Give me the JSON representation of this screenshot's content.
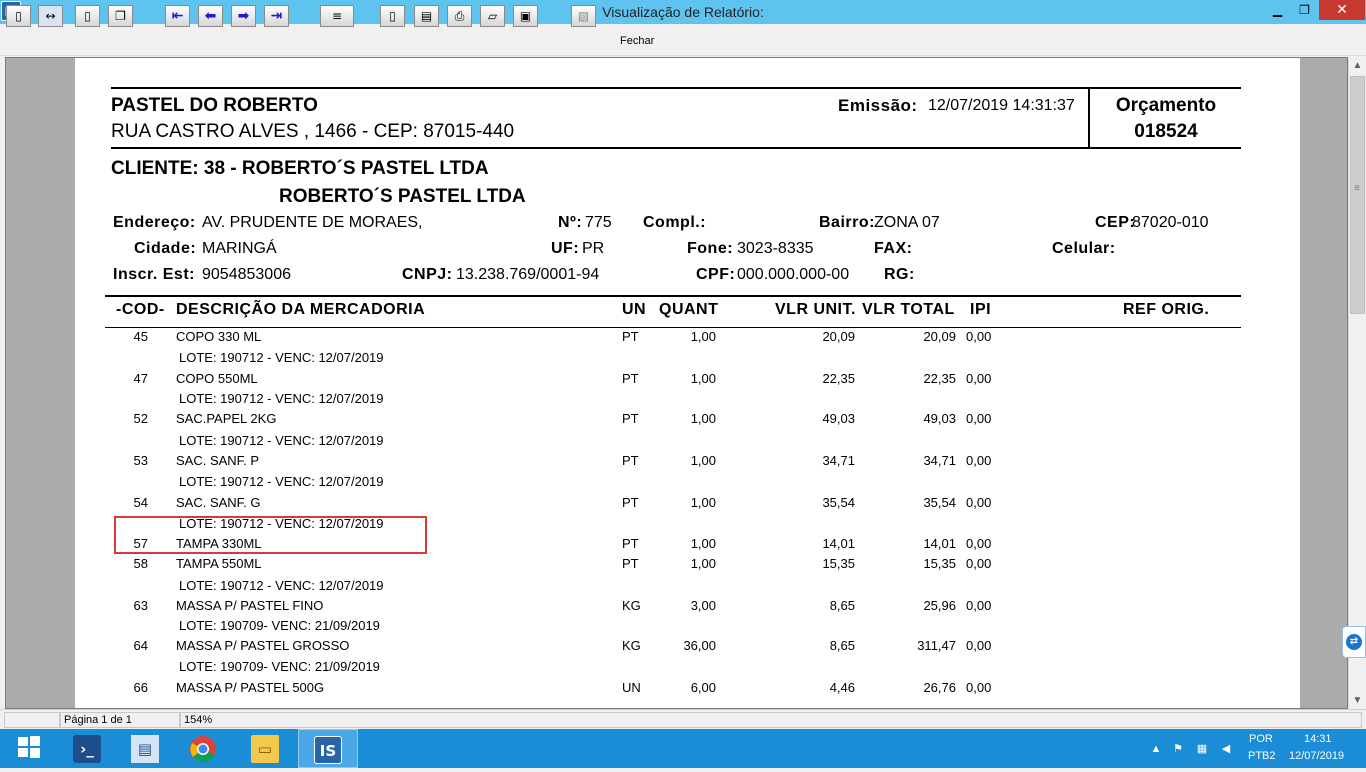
{
  "window": {
    "title": "Visualização de Relatório:",
    "app_icon": "IS",
    "min": "▁",
    "max": "❐",
    "close": "✕"
  },
  "toolbar": {
    "buttons": [
      {
        "name": "one-page-icon",
        "glyph": "▯"
      },
      {
        "name": "page-width-icon",
        "glyph": "↔"
      },
      {
        "name": "full-page-icon",
        "glyph": "▯"
      },
      {
        "name": "multi-page-icon",
        "glyph": "❐"
      },
      {
        "name": "first-page-icon",
        "glyph": "⇤"
      },
      {
        "name": "prev-page-icon",
        "glyph": "⬅"
      },
      {
        "name": "next-page-icon",
        "glyph": "➡"
      },
      {
        "name": "last-page-icon",
        "glyph": "⇥"
      },
      {
        "name": "goto-page-icon",
        "glyph": "≡"
      },
      {
        "name": "new-document-icon",
        "glyph": "▯"
      },
      {
        "name": "print-setup-icon",
        "glyph": "▤"
      },
      {
        "name": "print-icon",
        "glyph": "⎙"
      },
      {
        "name": "open-folder-icon",
        "glyph": "▱"
      },
      {
        "name": "save-icon",
        "glyph": "▣"
      },
      {
        "name": "disabled-icon",
        "glyph": "▧"
      }
    ],
    "close_label": "Fechar"
  },
  "report": {
    "company_name": "PASTEL DO ROBERTO",
    "company_address": "RUA CASTRO ALVES , 1466 - CEP: 87015-440",
    "emission_label": "Emissão:",
    "emission_value": "12/07/2019 14:31:37",
    "doc_type": "Orçamento",
    "doc_number": "018524",
    "client_line": "CLIENTE: 38 - ROBERTO´S PASTEL LTDA",
    "client_name": "ROBERTO´S PASTEL LTDA",
    "endereco_label": "Endereço:",
    "endereco_value": "AV. PRUDENTE DE MORAES,",
    "numero_label": "Nº:",
    "numero_value": "775",
    "compl_label": "Compl.:",
    "bairro_label": "Bairro:",
    "bairro_value": "ZONA 07",
    "cep_label": "CEP:",
    "cep_value": "87020-010",
    "cidade_label": "Cidade:",
    "cidade_value": "MARINGÁ",
    "uf_label": "UF:",
    "uf_value": "PR",
    "fone_label": "Fone:",
    "fone_value": "3023-8335",
    "fax_label": "FAX:",
    "celular_label": "Celular:",
    "inscr_label": "Inscr. Est:",
    "inscr_value": "9054853006",
    "cnpj_label": "CNPJ:",
    "cnpj_value": "13.238.769/0001-94",
    "cpf_label": "CPF:",
    "cpf_value": "000.000.000-00",
    "rg_label": "RG:",
    "columns": {
      "cod": "-COD-",
      "desc": "DESCRIÇÃO DA MERCADORIA",
      "un": "UN",
      "quant": "QUANT",
      "vlr_unit": "VLR UNIT.",
      "vlr_total": "VLR TOTAL",
      "ipi": "IPI",
      "ref": "REF ORIG."
    },
    "rows": [
      {
        "cod": "45",
        "desc": "COPO 330 ML",
        "un": "PT",
        "quant": "1,00",
        "unit": "20,09",
        "total": "20,09",
        "ipi": "0,00",
        "lote": "LOTE: 190712 - VENC: 12/07/2019"
      },
      {
        "cod": "47",
        "desc": "COPO 550ML",
        "un": "PT",
        "quant": "1,00",
        "unit": "22,35",
        "total": "22,35",
        "ipi": "0,00",
        "lote": "LOTE: 190712 - VENC: 12/07/2019"
      },
      {
        "cod": "52",
        "desc": "SAC.PAPEL 2KG",
        "un": "PT",
        "quant": "1,00",
        "unit": "49,03",
        "total": "49,03",
        "ipi": "0,00",
        "lote": "LOTE: 190712 - VENC: 12/07/2019"
      },
      {
        "cod": "53",
        "desc": "SAC. SANF. P",
        "un": "PT",
        "quant": "1,00",
        "unit": "34,71",
        "total": "34,71",
        "ipi": "0,00",
        "lote": "LOTE: 190712 - VENC: 12/07/2019"
      },
      {
        "cod": "54",
        "desc": "SAC. SANF. G",
        "un": "PT",
        "quant": "1,00",
        "unit": "35,54",
        "total": "35,54",
        "ipi": "0,00",
        "lote": "LOTE: 190712 - VENC: 12/07/2019"
      },
      {
        "cod": "57",
        "desc": "TAMPA 330ML",
        "un": "PT",
        "quant": "1,00",
        "unit": "14,01",
        "total": "14,01",
        "ipi": "0,00",
        "lote": ""
      },
      {
        "cod": "58",
        "desc": "TAMPA 550ML",
        "un": "PT",
        "quant": "1,00",
        "unit": "15,35",
        "total": "15,35",
        "ipi": "0,00",
        "lote": "LOTE: 190712 - VENC: 12/07/2019"
      },
      {
        "cod": "63",
        "desc": "MASSA P/ PASTEL FINO",
        "un": "KG",
        "quant": "3,00",
        "unit": "8,65",
        "total": "25,96",
        "ipi": "0,00",
        "lote": "LOTE: 190709- VENC: 21/09/2019"
      },
      {
        "cod": "64",
        "desc": "MASSA P/ PASTEL GROSSO",
        "un": "KG",
        "quant": "36,00",
        "unit": "8,65",
        "total": "311,47",
        "ipi": "0,00",
        "lote": "LOTE: 190709- VENC: 21/09/2019"
      },
      {
        "cod": "66",
        "desc": "MASSA P/ PASTEL 500G",
        "un": "UN",
        "quant": "6,00",
        "unit": "4,46",
        "total": "26,76",
        "ipi": "0,00",
        "lote": ""
      }
    ]
  },
  "status": {
    "page": "Página 1 de 1",
    "zoom": "154%"
  },
  "taskbar": {
    "lang_top": "POR",
    "lang_bottom": "PTB2",
    "time": "14:31",
    "date": "12/07/2019",
    "app_label": "IS"
  },
  "colors": {
    "titlebar": "#5ec4ef",
    "taskbar": "#1b8cd6",
    "highlight": "#d83a3a",
    "close": "#c7392e"
  }
}
